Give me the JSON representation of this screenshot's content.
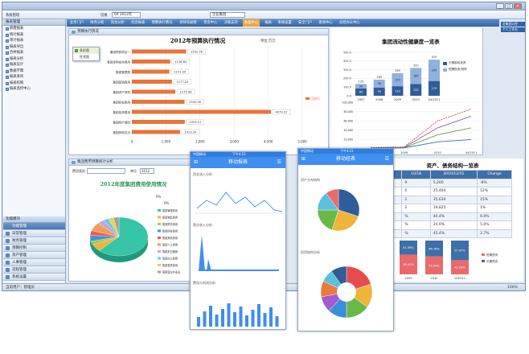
{
  "app": {
    "title": "",
    "window_buttons": [
      "_",
      "□",
      "×"
    ]
  },
  "toolbar": {
    "items": [
      "系统管理",
      "切换"
    ],
    "period_select": "04 2012年",
    "org_select": "企业集团"
  },
  "menubar": {
    "items": [
      "业务门户",
      "财务分析",
      "资金分析",
      "综合报表",
      "预算执行情况",
      "领导驾驶舱",
      "资金中心",
      "决策支持",
      "数据中心",
      "报表",
      "系统设置",
      "安全门户",
      "查询中心",
      "总经办公中心"
    ],
    "active_index": 8
  },
  "top_right_buttons": [
    "全集团口径",
    "个人工作台"
  ],
  "sidebar": {
    "tree_header": "报表管理",
    "tree_items": [
      "新建报表",
      "统计报表",
      "审计报表",
      "报表导出",
      "合并报表",
      "报表分析",
      "报表设计",
      "数据字典",
      "报表查询",
      "报表权限",
      "报表监控中心"
    ],
    "modules_header": "功能模块",
    "modules": [
      "功能管理",
      "日常管理",
      "财务管理",
      "预算控制",
      "资产管理",
      "人事管理",
      "流程管理",
      "系统设置"
    ],
    "selected_module_index": 0
  },
  "statusbar": {
    "left": "当前用户：管理员",
    "zoom": "100%"
  },
  "panel_budget": {
    "header": "预算执行情况",
    "unit": "单位:万元",
    "popup_items": [
      "条形图",
      "柱状图"
    ],
    "legend": "已执行"
  },
  "panel_health": {
    "legend": [
      "长期股权投资",
      "短期投资/其他"
    ]
  },
  "panel_cost": {
    "header": "集团费用预算统计分析",
    "filter_label": "费用类别",
    "unit_label": "单位",
    "year": "2012",
    "title": "2012年度集团费用使用情况",
    "legend": [
      "集团管理费用",
      "集团销售费用",
      "集团财务费用",
      "集团研发费用",
      "集团其他费用",
      "集团人工费用",
      "集团折旧摊销",
      "集团办公费用",
      "集团差旅费用",
      "集团营业外支出"
    ],
    "pie_callouts": [
      "6%",
      "0%"
    ]
  },
  "panel_structure": {
    "title": "资产、债务结构一览表"
  },
  "phone1": {
    "status": "中国移动",
    "time": "下午4:21",
    "title": "移动报表",
    "sections": [
      "资金流入分析",
      "营业收入分析",
      "费用与利润分析"
    ]
  },
  "phone2": {
    "status": "中国移动",
    "time": "下午4:21",
    "title": "移动经表",
    "sections": [
      "资产分布结构",
      "投资结构分析"
    ]
  },
  "chart_data": [
    {
      "type": "bar",
      "orientation": "horizontal",
      "title": "2012年预算执行情况",
      "categories": [
        "集团预算项目一",
        "集团采购成本费用",
        "集团管理费",
        "集团营销费用",
        "集团资产采购",
        "集团研发费用",
        "集团投资费用",
        "集团财产保险",
        "集团其他支出"
      ],
      "values": [
        1592.78,
        1126.84,
        1101.39,
        1177.22,
        1275.48,
        1545.56,
        4079.22,
        1553.21,
        1413.39
      ],
      "xlim": [
        0,
        5000
      ],
      "xticks": [
        "0",
        "1,000",
        "2,000",
        "3,000",
        "4,000",
        "5,000"
      ],
      "color": "#e8753a"
    },
    {
      "type": "bar",
      "stacked": true,
      "title": "集团流动性健康度一览表",
      "categories": [
        "2007",
        "2008",
        "2009",
        "2010",
        "04/2011"
      ],
      "series": [
        {
          "name": "长期股权投资",
          "values": [
            85,
            95,
            110,
            135,
            170
          ]
        },
        {
          "name": "短期投资/其他",
          "values": [
            50,
            90,
            150,
            185,
            245
          ]
        }
      ],
      "ylim": [
        0,
        500
      ],
      "yticks": [
        "0.0",
        "50.0",
        "100.0",
        "150.0",
        "200.0",
        "250.0",
        "300.0",
        "350.0",
        "400.0",
        "450.0",
        "500.0"
      ],
      "stack_labels": [
        "135",
        "185",
        "260",
        "320",
        "415"
      ]
    },
    {
      "type": "line",
      "categories": [
        "2008",
        "2009",
        "2010",
        "04/2011"
      ],
      "series": [
        {
          "name": "",
          "values": [
            3000,
            4000,
            60000,
            85000
          ]
        },
        {
          "name": "",
          "values": [
            2000,
            3000,
            45000,
            70000
          ]
        },
        {
          "name": "",
          "values": [
            1500,
            2500,
            30000,
            45000
          ]
        },
        {
          "name": "",
          "values": [
            1000,
            2000,
            15000,
            20000
          ]
        }
      ],
      "ylim": [
        0,
        100000
      ],
      "yticks": [
        "0",
        "10,000",
        "20,000",
        "30,000",
        "40,000",
        "50,000",
        "60,000",
        "70,000",
        "80,000",
        "90,000",
        "100,000"
      ]
    },
    {
      "type": "pie",
      "title": "2012年度集团费用使用情况",
      "labels": [
        "集团管理费用",
        "集团销售费用",
        "集团财务费用",
        "集团研发费用",
        "集团其他费用",
        "集团人工费用",
        "集团折旧摊销",
        "集团办公费用",
        "集团差旅费用",
        "集团营业外支出"
      ],
      "values": [
        62,
        6,
        3,
        5,
        4,
        7,
        4,
        3,
        3,
        3
      ],
      "colors": [
        "#36c5a6",
        "#f0b43a",
        "#9dcf46",
        "#4a90d9",
        "#e85c5c",
        "#f39c52",
        "#c9a3d9",
        "#6ec7e8",
        "#e8d44a",
        "#a0a0a0"
      ]
    },
    {
      "type": "table",
      "title": "资产、债务结构一览表",
      "columns": [
        "",
        "10/18",
        "2010/12/31",
        "Change"
      ],
      "rows": [
        [
          "",
          "9",
          "5,200",
          "-8%"
        ],
        [
          "",
          "0",
          "25,464",
          "12%"
        ],
        [
          "",
          "2",
          "35,634",
          "15%"
        ],
        [
          "",
          "2",
          "19,825",
          "1%"
        ],
        [
          "",
          "%",
          "40.4%",
          "6.0%"
        ],
        [
          "",
          "%",
          "24.0%",
          "5.0%"
        ],
        [
          "",
          "%",
          "45.4%",
          "2.7%"
        ]
      ]
    },
    {
      "type": "bar",
      "stacked": true,
      "categories": [
        "2009",
        "2010",
        "1H2011"
      ],
      "series": [
        {
          "name": "短期债务",
          "values": [
            58.42,
            53.24,
            42.03
          ]
        },
        {
          "name": "长期债务",
          "values": [
            41.58,
            46.76,
            57.97
          ]
        }
      ],
      "data_labels": [
        "58.42%",
        "41.58%",
        "53.24%",
        "46.76%",
        "42.03%",
        "57.97%"
      ]
    }
  ]
}
